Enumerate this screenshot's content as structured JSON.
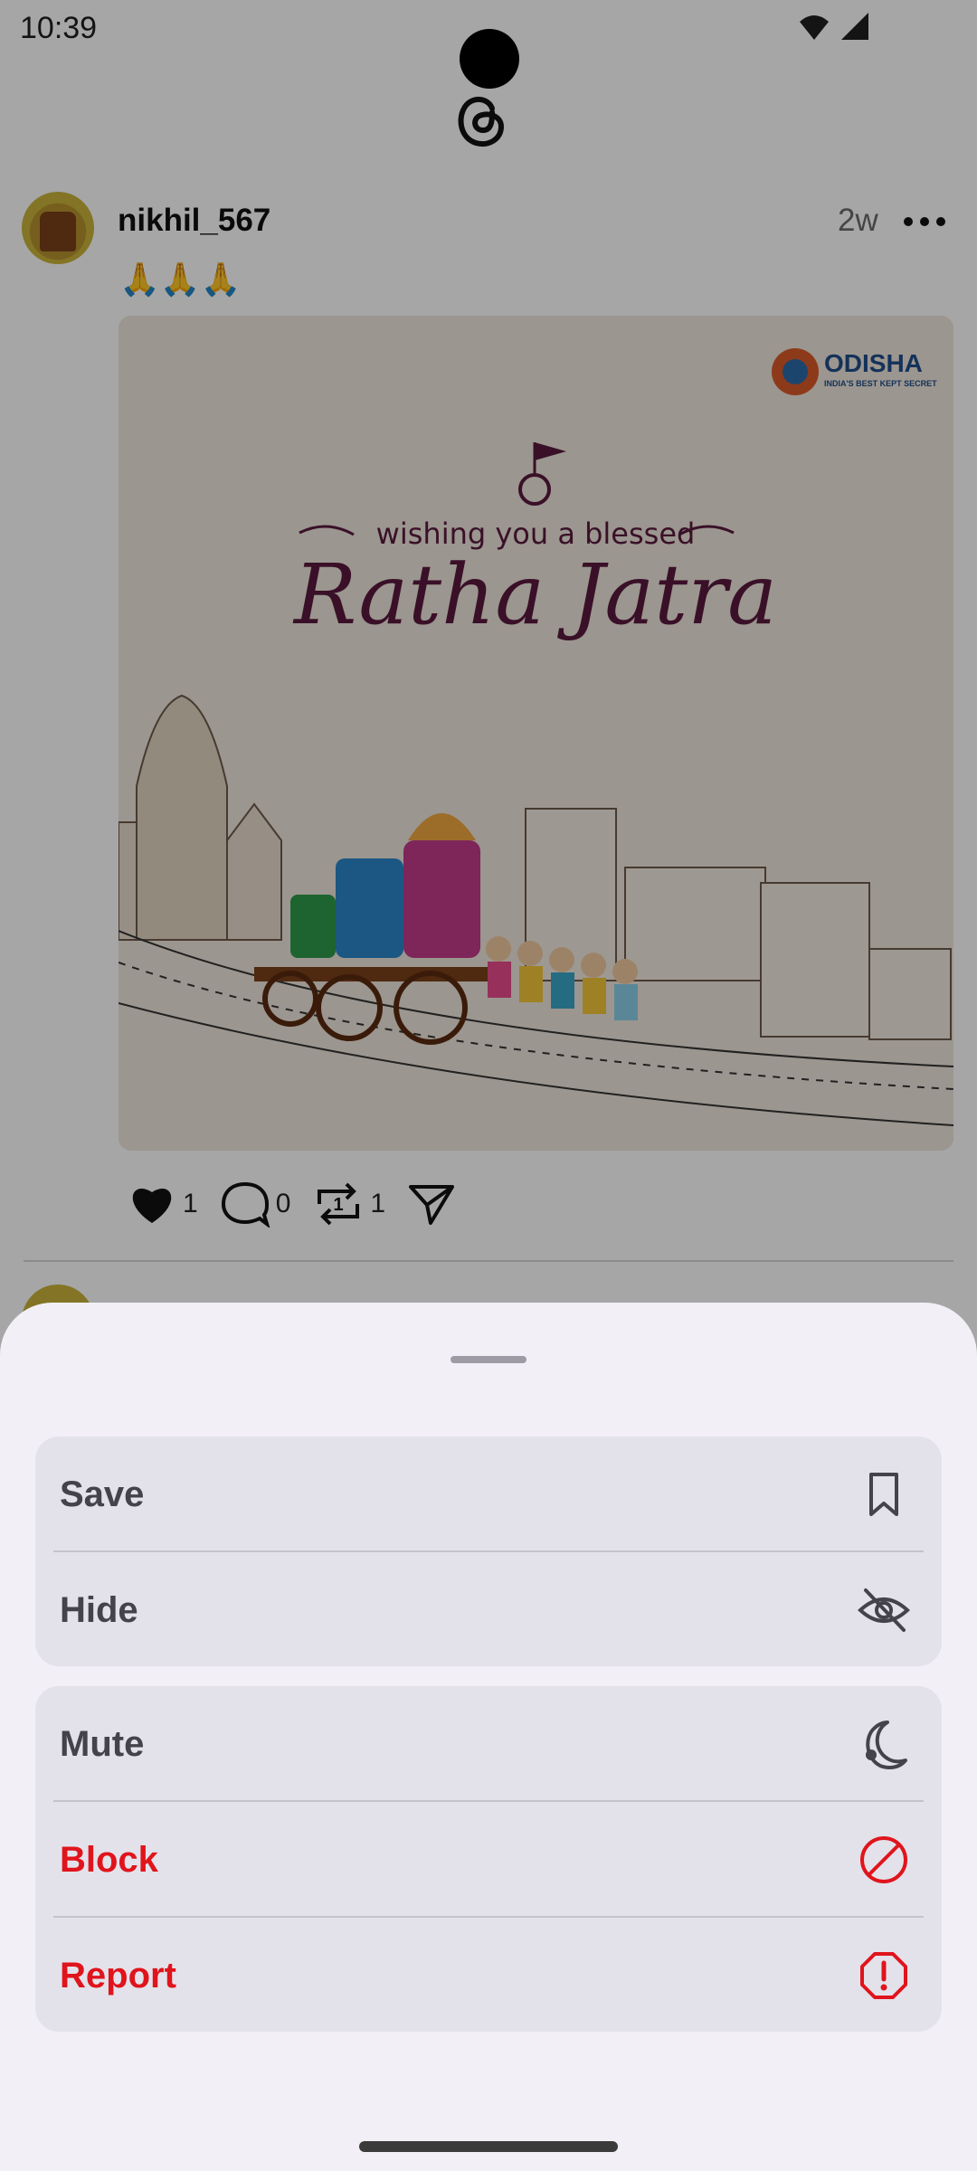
{
  "status_bar": {
    "time": "10:39"
  },
  "post": {
    "username": "nikhil_567",
    "age": "2w",
    "text": "🙏🙏🙏",
    "image": {
      "brand": "ODISHA",
      "brand_tagline": "INDIA'S BEST KEPT SECRET",
      "greeting": "wishing you a blessed",
      "headline": "Ratha Jatra"
    },
    "actions": {
      "likes": "1",
      "comments": "0",
      "reposts": "1"
    }
  },
  "sheet": {
    "group1": [
      {
        "label": "Save",
        "icon": "bookmark-icon"
      },
      {
        "label": "Hide",
        "icon": "eye-off-icon"
      }
    ],
    "group2": [
      {
        "label": "Mute",
        "icon": "moon-icon"
      },
      {
        "label": "Block",
        "icon": "block-icon"
      },
      {
        "label": "Report",
        "icon": "report-icon"
      }
    ]
  },
  "colors": {
    "danger": "#e0141c",
    "sheet_bg": "#f2f0f6",
    "group_bg": "#e3e2ea"
  }
}
